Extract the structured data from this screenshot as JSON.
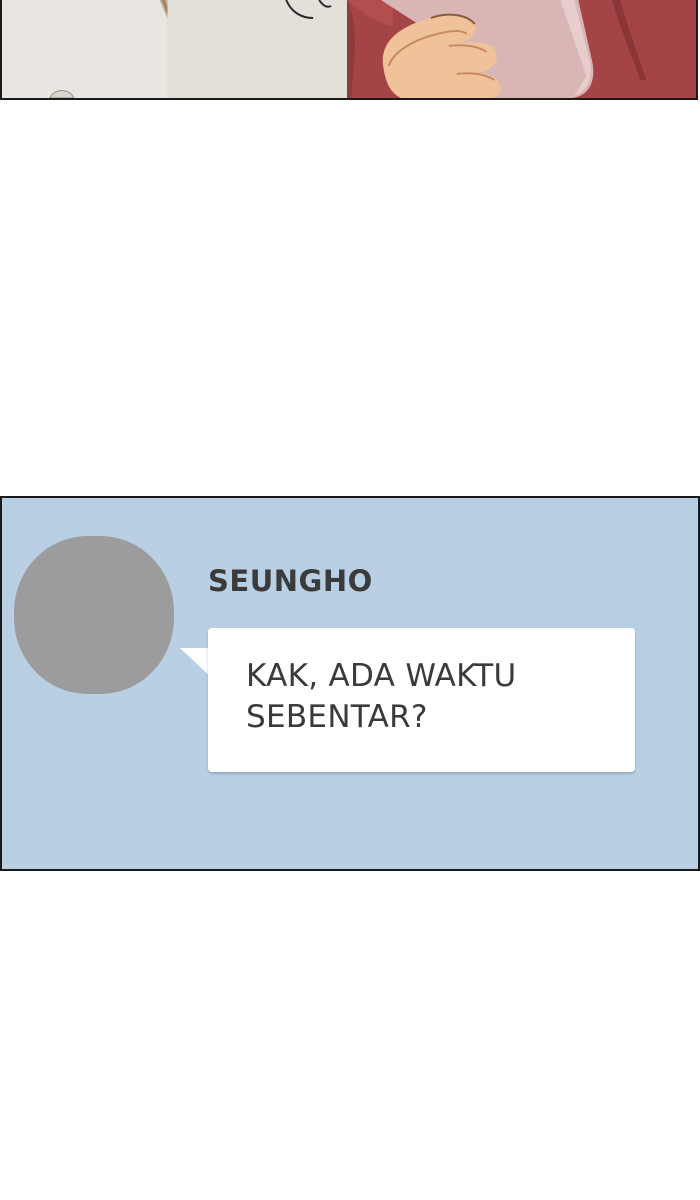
{
  "chat": {
    "sender_name": "SEUNGHO",
    "message_lines": [
      "KAK, ADA WAKTU",
      "SEBENTAR?"
    ]
  },
  "colors": {
    "chat_background": "#b8cfe4",
    "avatar_placeholder": "#9c9c9c",
    "bubble": "#ffffff",
    "panel_border": "#1a1a1a",
    "sleeve_red": "#a54446"
  }
}
